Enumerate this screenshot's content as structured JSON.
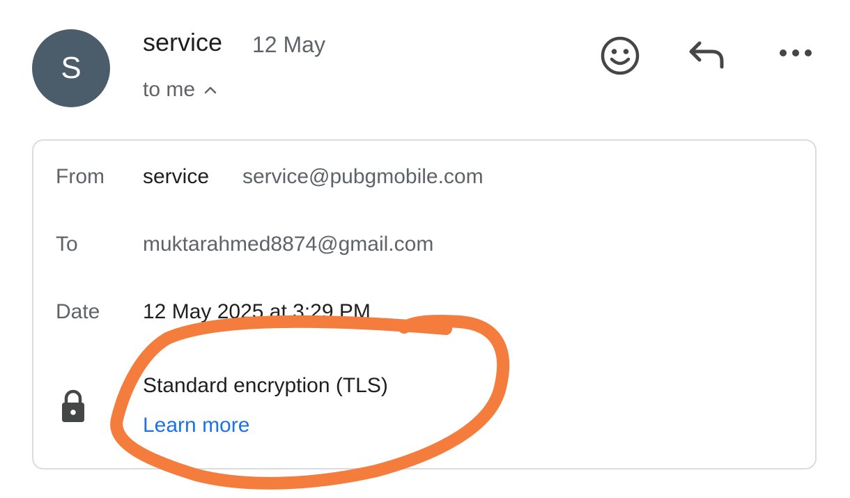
{
  "message": {
    "avatar_letter": "S",
    "sender": "service",
    "date_short": "12 May",
    "recipient_summary": "to me"
  },
  "details": {
    "from_label": "From",
    "from_name": "service",
    "from_email": "service@pubgmobile.com",
    "to_label": "To",
    "to_email": "muktarahmed8874@gmail.com",
    "date_label": "Date",
    "date_full": "12 May 2025 at 3:29 PM",
    "encryption_text": "Standard encryption (TLS)",
    "learn_more": "Learn more"
  },
  "icons": {
    "avatar": "avatar",
    "recipients_toggle": "chevron-up-icon",
    "reaction": "emoji-icon",
    "reply": "reply-icon",
    "more": "more-horizontal-icon",
    "security": "lock-icon",
    "annotation": "hand-drawn-orange-circle"
  },
  "colors": {
    "avatar_bg": "#4b5d6b",
    "link": "#1a73e8",
    "secondary_text": "#5f6368",
    "annotation": "#f47c3c",
    "border": "#dadce0"
  }
}
